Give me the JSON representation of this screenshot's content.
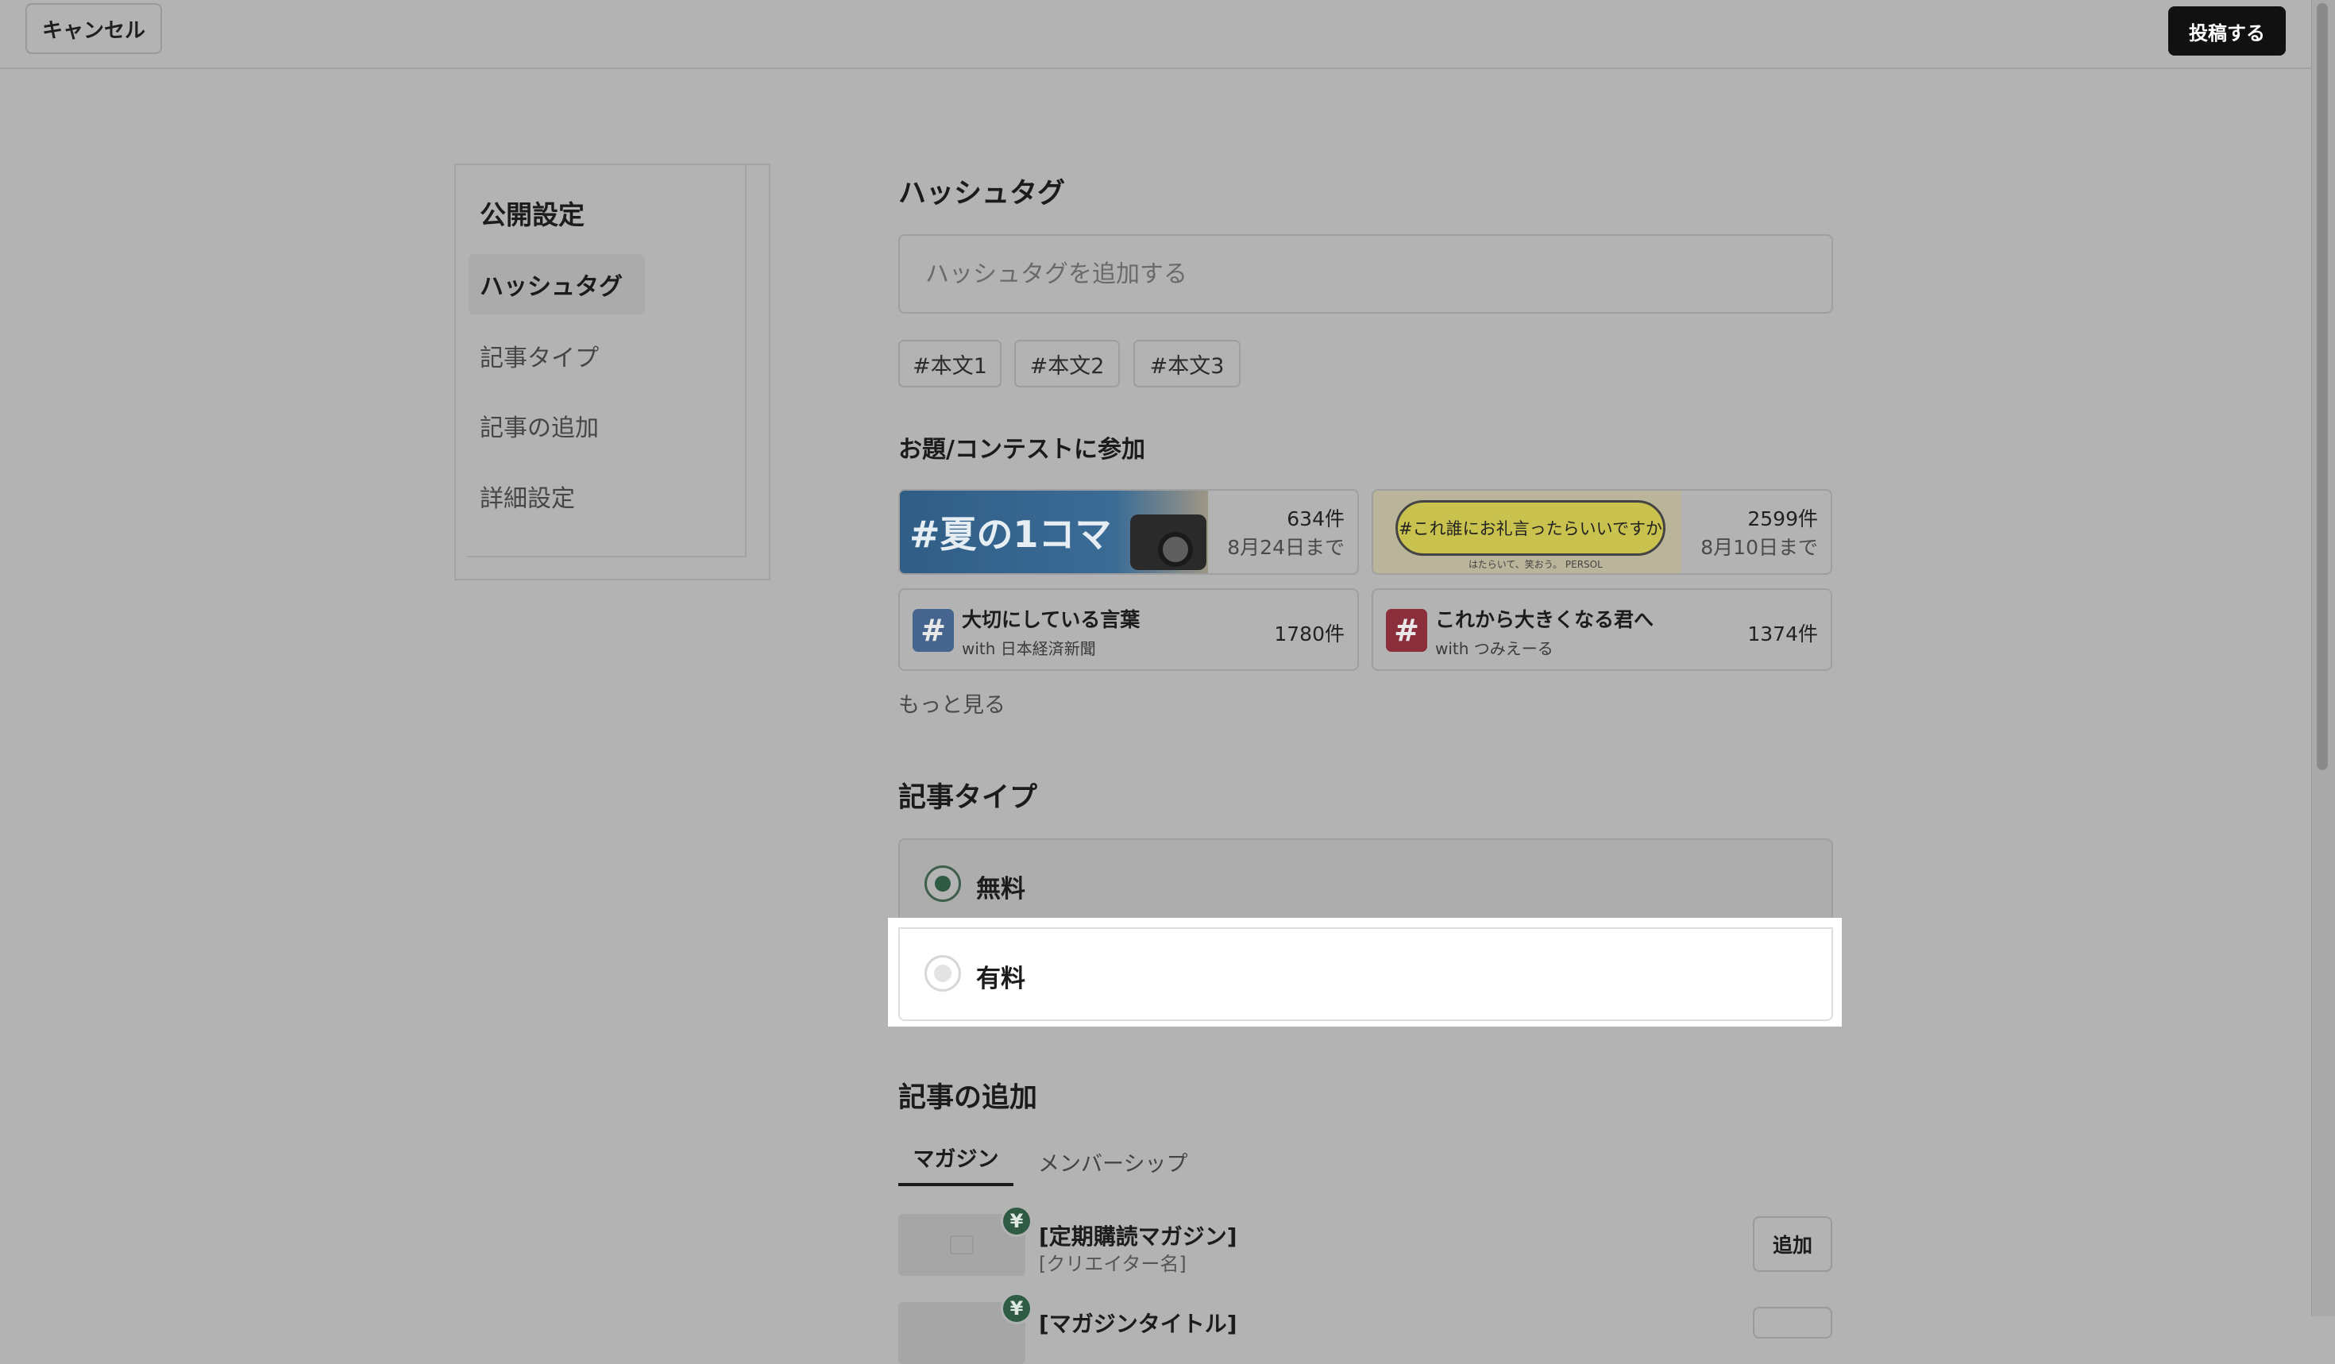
{
  "header": {
    "cancel_label": "キャンセル",
    "post_label": "投稿する"
  },
  "sidebar": {
    "title": "公開設定",
    "items": [
      {
        "label": "ハッシュタグ",
        "active": true
      },
      {
        "label": "記事タイプ",
        "active": false
      },
      {
        "label": "記事の追加",
        "active": false
      },
      {
        "label": "詳細設定",
        "active": false
      }
    ]
  },
  "hashtag": {
    "heading": "ハッシュタグ",
    "input_placeholder": "ハッシュタグを追加する",
    "input_value": "",
    "chips": [
      "#本文1",
      "#本文2",
      "#本文3"
    ]
  },
  "contest": {
    "heading": "お題/コンテストに参加",
    "banners": [
      {
        "banner_text": "#夏の1コマ",
        "count": "634件",
        "deadline": "8月24日まで",
        "icon": "camera-icon"
      },
      {
        "banner_text": "#これ誰にお礼言ったらいいですか",
        "banner_footer": "はたらいて、笑おう。 PERSOL",
        "count": "2599件",
        "deadline": "8月10日まで"
      }
    ],
    "tags": [
      {
        "title": "大切にしている言葉",
        "with": "with 日本経済新聞",
        "count": "1780件",
        "icon_color": "#46658e"
      },
      {
        "title": "これから大きくなる君へ",
        "with": "with つみえーる",
        "count": "1374件",
        "icon_color": "#8a2e3c"
      }
    ],
    "more_label": "もっと見る"
  },
  "article_type": {
    "heading": "記事タイプ",
    "options": [
      {
        "label": "無料",
        "selected": true
      },
      {
        "label": "有料",
        "selected": false
      }
    ]
  },
  "add_article": {
    "heading": "記事の追加",
    "tabs": [
      {
        "label": "マガジン",
        "active": true
      },
      {
        "label": "メンバーシップ",
        "active": false
      }
    ],
    "magazines": [
      {
        "title": "[定期購読マガジン]",
        "creator": "[クリエイター名]",
        "add_label": "追加",
        "badge": "¥"
      },
      {
        "title": "[マガジンタイトル]",
        "badge": "¥"
      }
    ]
  },
  "colors": {
    "overlay_gray": "#b3b3b3",
    "accent_green": "#2f5a44",
    "post_button": "#111111"
  }
}
